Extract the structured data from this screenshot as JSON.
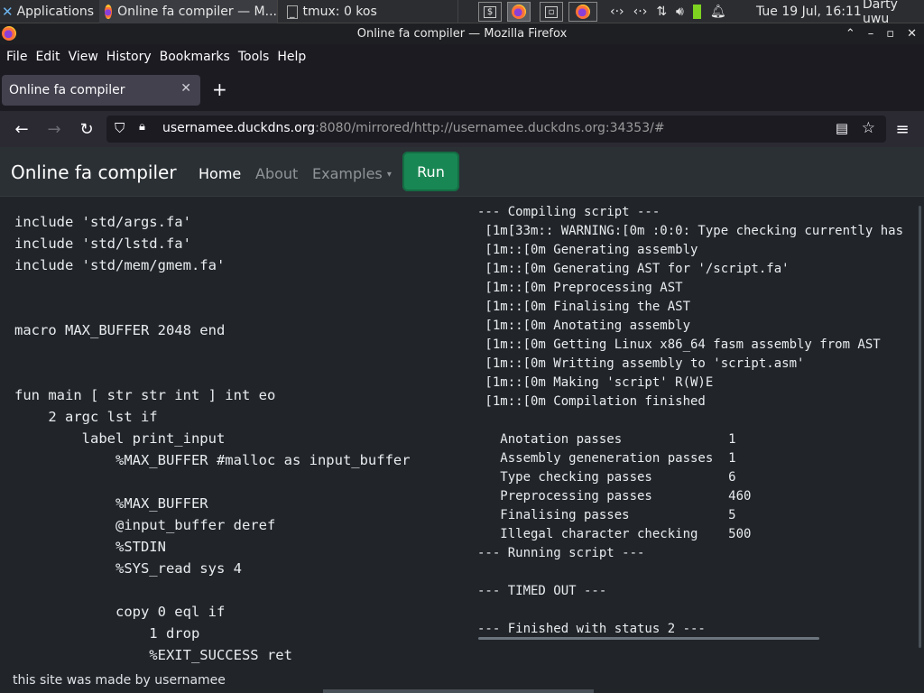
{
  "taskbar": {
    "apps_label": "Applications",
    "window1": "Online fa compiler — M...",
    "window2": "tmux: 0 kos",
    "clock": "Tue 19 Jul, 16:11",
    "user": "Darty uwu"
  },
  "window": {
    "title": "Online fa compiler — Mozilla Firefox"
  },
  "menu": {
    "file": "File",
    "edit": "Edit",
    "view": "View",
    "history": "History",
    "bookmarks": "Bookmarks",
    "tools": "Tools",
    "help": "Help"
  },
  "tab": {
    "title": "Online fa compiler"
  },
  "urlbar": {
    "host": "usernamee.duckdns.org",
    "rest": ":8080/mirrored/http://usernamee.duckdns.org:34353/#"
  },
  "site": {
    "brand": "Online fa compiler",
    "nav": {
      "home": "Home",
      "about": "About",
      "examples": "Examples"
    },
    "run": "Run",
    "footer": "this site was made by usernamee"
  },
  "code_lines": [
    "include 'std/args.fa'",
    "include 'std/lstd.fa'",
    "include 'std/mem/gmem.fa'",
    "",
    "",
    "macro MAX_BUFFER 2048 end",
    "",
    "",
    "fun main [ str str int ] int eo",
    "    2 argc lst if",
    "        label print_input",
    "            %MAX_BUFFER #malloc as input_buffer",
    "",
    "            %MAX_BUFFER",
    "            @input_buffer deref",
    "            %STDIN",
    "            %SYS_read sys 4",
    "",
    "            copy 0 eql if",
    "                1 drop",
    "                %EXIT_SUCCESS ret"
  ],
  "output_lines": [
    "--- Compiling script ---",
    " [1m[33m:: WARNING:[0m :0:0: Type checking currently has",
    " [1m::[0m Generating assembly",
    " [1m::[0m Generating AST for '/script.fa'",
    " [1m::[0m Preprocessing AST",
    " [1m::[0m Finalising the AST",
    " [1m::[0m Anotating assembly",
    " [1m::[0m Getting Linux x86_64 fasm assembly from AST",
    " [1m::[0m Writting assembly to 'script.asm'",
    " [1m::[0m Making 'script' R(W)E",
    " [1m::[0m Compilation finished",
    "",
    "   Anotation passes              1",
    "   Assembly geneneration passes  1",
    "   Type checking passes          6",
    "   Preprocessing passes          460",
    "   Finalising passes             5",
    "   Illegal character checking    500",
    "--- Running script ---",
    "",
    "--- TIMED OUT ---",
    "",
    "--- Finished with status 2 ---"
  ]
}
